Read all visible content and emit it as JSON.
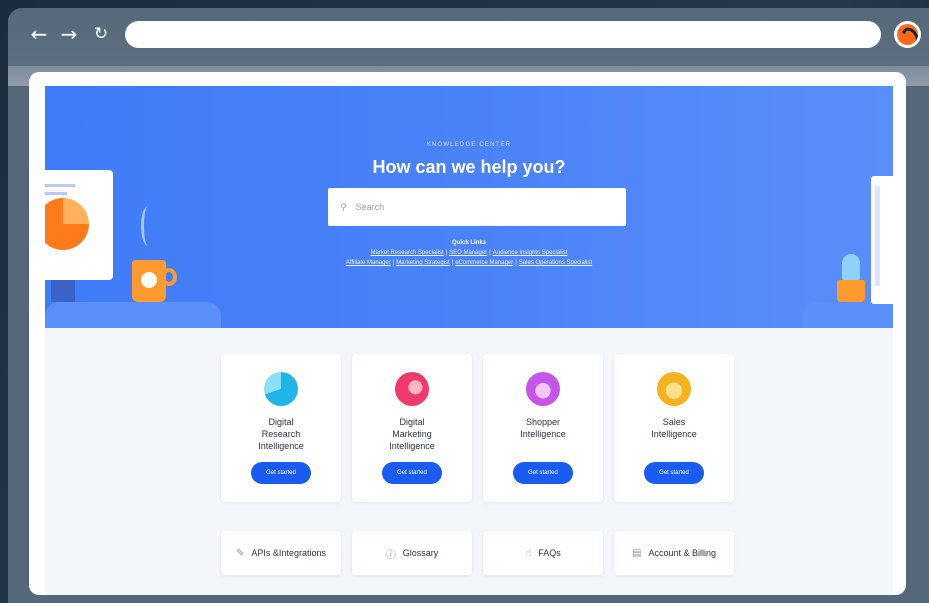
{
  "browser": {
    "back_icon": "arrow-left-icon",
    "forward_icon": "arrow-right-icon",
    "reload_icon": "reload-icon",
    "url": "",
    "profile_icon": "semrush-logo-icon"
  },
  "hero": {
    "kicker": "KNOWLEDGE CENTER",
    "title": "How can we help you?",
    "search_placeholder": "Search",
    "quick_links_title": "Quick Links",
    "quick_links_row1": [
      "Market Research Specialist",
      "SEO Manager",
      "Audience Insights Specialist"
    ],
    "quick_links_row2": [
      "Affiliate Manager",
      "Marketing Strategist",
      "eCommerce Manager",
      "Sales Operations Specialist"
    ],
    "separator": "|"
  },
  "cards": [
    {
      "title": "Digital\nResearch\nIntelligence",
      "button": "Get started",
      "icon": "research-icon",
      "color": "#1fb5e6"
    },
    {
      "title": "Digital\nMarketing\nIntelligence",
      "button": "Get started",
      "icon": "marketing-megaphone-icon",
      "color": "#f03a6b"
    },
    {
      "title": "Shopper\nIntelligence",
      "button": "Get started",
      "icon": "shopper-bag-icon",
      "color": "#c455e8"
    },
    {
      "title": "Sales\nIntelligence",
      "button": "Get started",
      "icon": "sales-wallet-icon",
      "color": "#f7b21f"
    }
  ],
  "links": [
    {
      "label": "APIs &Integrations",
      "icon": "pencil-icon"
    },
    {
      "label": "Glossary",
      "icon": "info-icon"
    },
    {
      "label": "FAQs",
      "icon": "thumbs-up-icon"
    },
    {
      "label": "Account & Billing",
      "icon": "document-icon"
    }
  ],
  "colors": {
    "hero_blue": "#4a82f8",
    "primary_button": "#1a5cf0",
    "accent_orange": "#ff9a2e"
  }
}
